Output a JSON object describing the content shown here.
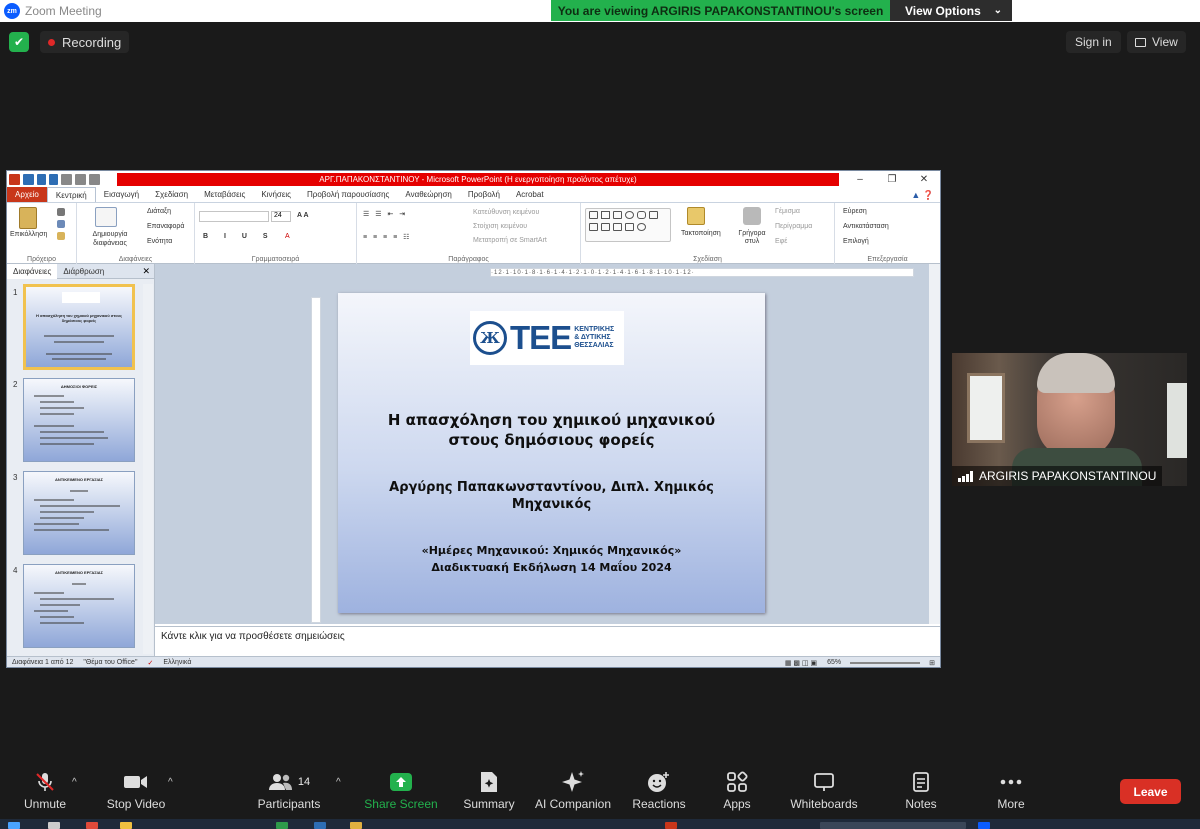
{
  "window": {
    "title": "Zoom Meeting",
    "logo_text": "zm"
  },
  "share_banner": {
    "message": "You are viewing ARGIRIS PAPAKONSTANTINOU's screen",
    "view_options": "View Options"
  },
  "top": {
    "recording": "Recording",
    "sign_in": "Sign in",
    "view": "View"
  },
  "ppt": {
    "title": "ΑΡΓ.ΠΑΠΑΚΟΝΣΤΑΝΤΙΝΟΥ  -  Microsoft PowerPoint (Η ενεργοποίηση προϊόντος απέτυχε)",
    "tabs": [
      "Αρχείο",
      "Κεντρική",
      "Εισαγωγή",
      "Σχεδίαση",
      "Μεταβάσεις",
      "Κινήσεις",
      "Προβολή παρουσίασης",
      "Αναθεώρηση",
      "Προβολή",
      "Acrobat"
    ],
    "ribbon": {
      "paste": "Επικόλληση",
      "clipboard": "Πρόχειρο",
      "new_slide": "Δημιουργία διαφάνειας",
      "layout": "Διάταξη",
      "reset": "Επαναφορά",
      "section": "Ενότητα",
      "slides_group": "Διαφάνειες",
      "font_size": "24",
      "font_group": "Γραμματοσειρά",
      "text_direction": "Κατεύθυνση κειμένου",
      "align_text": "Στοίχιση κειμένου",
      "smartart": "Μετατροπή σε SmartArt",
      "paragraph_group": "Παράγραφος",
      "arrange": "Τακτοποίηση",
      "quick_styles": "Γρήγορα στυλ",
      "fill": "Γέμισμα",
      "outline": "Περίγραμμα",
      "effects": "Εφέ",
      "drawing_group": "Σχεδίαση",
      "find": "Εύρεση",
      "replace": "Αντικατάσταση",
      "select": "Επιλογή",
      "editing_group": "Επεξεργασία"
    },
    "pane_tabs": [
      "Διαφάνειες",
      "Διάρθρωση"
    ],
    "thumbs": [
      {
        "num": "1",
        "title": "Η απασχόληση του χημικού μηχανικού στους δημόσιους φορείς"
      },
      {
        "num": "2",
        "title": "ΔΗΜΟΣΙΟΙ ΦΟΡΕΙΣ"
      },
      {
        "num": "3",
        "title": "ΑΝΤΙΚΕΙΜΕΝΟ ΕΡΓΑΣΙΑΣ"
      },
      {
        "num": "4",
        "title": "ΑΝΤΙΚΕΙΜΕΝΟ ΕΡΓΑΣΙΑΣ"
      }
    ],
    "ruler": "·12·1·10·1·8·1·6·1·4·1·2·1·0·1·2·1·4·1·6·1·8·1·10·1·12·",
    "slide": {
      "logo_mark": "Ж",
      "logo_tee": "ΤΕΕ",
      "logo_sub": [
        "ΚΕΝΤΡΙΚΗΣ",
        "& ΔΥΤΙΚΗΣ",
        "ΘΕΣΣΑΛΙΑΣ"
      ],
      "title_line1": "Η απασχόληση του χημικού μηχανικού",
      "title_line2": "στους δημόσιους φορείς",
      "author_line1": "Αργύρης Παπακωνσταντίνου, Διπλ. Χημικός",
      "author_line2": "Μηχανικός",
      "event_line1": "«Ημέρες Μηχανικού: Χημικός Μηχανικός»",
      "event_line2": "Διαδικτυακή Εκδήλωση  14 Μαΐου 2024"
    },
    "notes": "Κάντε κλικ για να προσθέσετε σημειώσεις",
    "status": {
      "slide": "Διαφάνεια 1 από 12",
      "theme": "\"Θέμα του Office\"",
      "lang": "Ελληνικά",
      "zoom": "65%"
    }
  },
  "video": {
    "name": "ARGIRIS PAPAKONSTANTINOU"
  },
  "toolbar": [
    {
      "label": "Unmute",
      "icon": "mic-muted-icon"
    },
    {
      "label": "Stop Video",
      "icon": "video-camera-icon"
    },
    {
      "label": "Participants",
      "icon": "participants-icon",
      "count": "14"
    },
    {
      "label": "Share Screen",
      "icon": "share-screen-icon"
    },
    {
      "label": "Summary",
      "icon": "summary-icon"
    },
    {
      "label": "AI Companion",
      "icon": "ai-companion-icon"
    },
    {
      "label": "Reactions",
      "icon": "reactions-icon"
    },
    {
      "label": "Apps",
      "icon": "apps-icon"
    },
    {
      "label": "Whiteboards",
      "icon": "whiteboard-icon"
    },
    {
      "label": "Notes",
      "icon": "notes-icon"
    },
    {
      "label": "More",
      "icon": "more-icon"
    }
  ],
  "leave": "Leave",
  "colors": {
    "zoom_green": "#23b14d",
    "leave_red": "#d93025",
    "ppt_red": "#e50000",
    "tee_blue": "#1c4f8e"
  }
}
